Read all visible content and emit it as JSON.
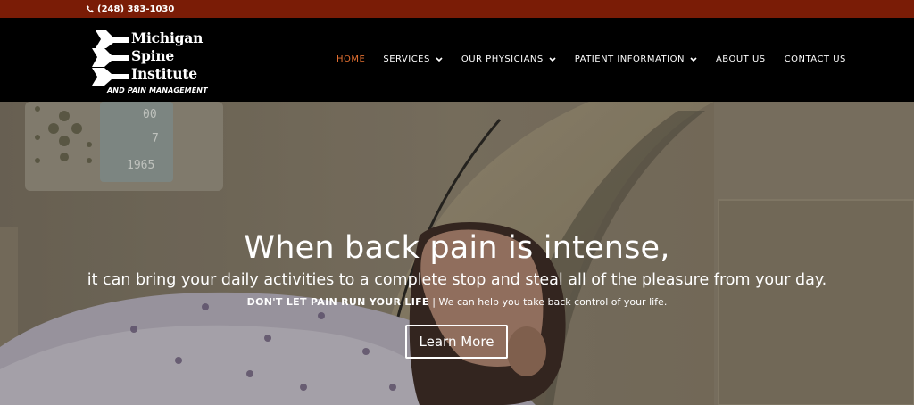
{
  "topbar": {
    "phone": "(248) 383-1030",
    "icon": "phone-icon"
  },
  "logo": {
    "line1": "Michigan",
    "line2": "Spine",
    "line3": "Institute",
    "subtitle": "AND PAIN MANAGEMENT"
  },
  "nav": {
    "items": [
      {
        "label": "HOME",
        "active": true
      },
      {
        "label": "SERVICES",
        "dropdown": true
      },
      {
        "label": "OUR PHYSICIANS",
        "dropdown": true
      },
      {
        "label": "PATIENT INFORMATION",
        "dropdown": true
      },
      {
        "label": "ABOUT US"
      },
      {
        "label": "CONTACT US"
      }
    ]
  },
  "hero": {
    "headline": "When back pain is intense,",
    "subline": "it can bring your daily activities to a complete stop and steal all of the pleasure from your day.",
    "tagline_bold": "DON'T LET PAIN RUN YOUR LIFE",
    "tagline_rest": " | We can help you take back control of your life.",
    "cta_label": "Learn More",
    "scanner_readout": [
      "00",
      "7",
      "1965"
    ]
  },
  "colors": {
    "topbar": "#7a1c06",
    "accent": "#e47031",
    "header": "#000000"
  }
}
